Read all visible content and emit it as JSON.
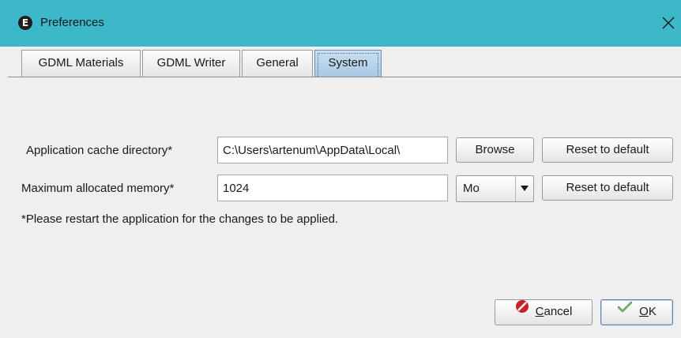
{
  "window": {
    "title": "Preferences",
    "app_icon_letter": "E"
  },
  "tabs": [
    {
      "label": "GDML Materials"
    },
    {
      "label": "GDML Writer"
    },
    {
      "label": "General"
    },
    {
      "label": "System",
      "selected": true
    }
  ],
  "system": {
    "cache_dir_label": "Application cache directory*",
    "cache_dir_value": "C:\\Users\\artenum\\AppData\\Local\\",
    "browse_label": "Browse",
    "reset_label_1": "Reset to default",
    "memory_label": "Maximum allocated memory*",
    "memory_value": "1024",
    "memory_unit": "Mo",
    "reset_label_2": "Reset to default",
    "note": "*Please restart the application for the changes to be applied."
  },
  "footer": {
    "cancel_first_letter": "C",
    "cancel_rest": "ancel",
    "ok_first_letter": "O",
    "ok_rest": "K"
  },
  "colors": {
    "titlebar": "#3db8c9",
    "background": "#efefef",
    "selected_tab": "#b3cfe8",
    "cancel_icon": "#c8202a",
    "ok_check": "#3f8f2f"
  }
}
